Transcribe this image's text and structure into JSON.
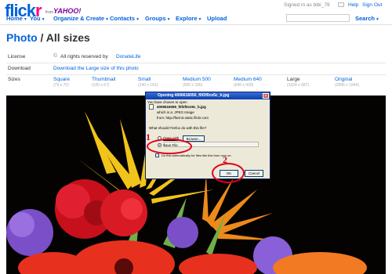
{
  "header": {
    "logo": {
      "left": "flick",
      "right": "r"
    },
    "from_text": "from",
    "yahoo_text": "YAHOO!",
    "signed_in": "Signed in as bibi_79",
    "links": {
      "help": "Help",
      "sign_out": "Sign Out"
    }
  },
  "nav": {
    "items": [
      {
        "label": "Home"
      },
      {
        "label": "You"
      },
      {
        "label": "Organize & Create"
      },
      {
        "label": "Contacts"
      },
      {
        "label": "Groups"
      },
      {
        "label": "Explore"
      },
      {
        "label": "Upload"
      }
    ],
    "search_label": "Search"
  },
  "page": {
    "title_link": "Photo",
    "title_rest": " / All sizes"
  },
  "details": {
    "license_label": "License",
    "license_value": "All rights reserved by",
    "license_owner": "DonateLife",
    "download_label": "Download",
    "download_link": "Download the Large size of this photo",
    "sizes_label": "Sizes"
  },
  "sizes": [
    {
      "name": "Square",
      "dim": "(75 x 75)"
    },
    {
      "name": "Thumbnail",
      "dim": "(100 x 67)"
    },
    {
      "name": "Small",
      "dim": "(240 x 161)"
    },
    {
      "name": "Medium 500",
      "dim": "(500 x 335)"
    },
    {
      "name": "Medium 640",
      "dim": "(640 x 429)"
    },
    {
      "name": "Large",
      "dim": "(1024 x 687)"
    },
    {
      "name": "Original",
      "dim": "(2896 x 1944)"
    }
  ],
  "dialog": {
    "title": "Opening 4006616056_f0f2f0ce5c_b.jpg",
    "intro": "You have chosen to open",
    "filename": "4006616056_f0f2f0ce5c_b.jpg",
    "which_is": "which is a:  JPEG Image",
    "from": "from:  http://farm3.static.flickr.com",
    "question": "What should Firefox do with this file?",
    "open_with": "Open with",
    "browse": "Browse...",
    "save_file": "Save File",
    "auto": "Do this automatically for files like this from now on.",
    "ok": "OK",
    "cancel": "Cancel"
  },
  "annotations": {
    "step1": "1",
    "step2": "2"
  }
}
